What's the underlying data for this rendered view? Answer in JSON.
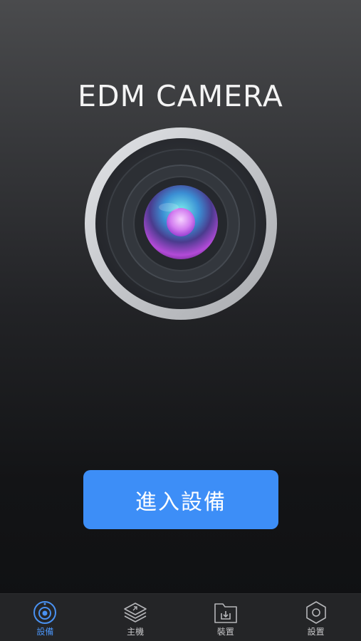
{
  "app": {
    "title": "EDM CAMERA"
  },
  "main": {
    "enter_button_label": "進入設備"
  },
  "tabbar": {
    "items": [
      {
        "label": "設備",
        "icon": "camera-icon",
        "active": true
      },
      {
        "label": "主機",
        "icon": "layers-icon",
        "active": false
      },
      {
        "label": "裝置",
        "icon": "folder-download-icon",
        "active": false
      },
      {
        "label": "設置",
        "icon": "settings-hexagon-icon",
        "active": false
      }
    ]
  },
  "colors": {
    "accent": "#3d8ef7",
    "active_tab": "#4a92f2",
    "inactive_tab": "#c7c7c9",
    "tabbar_bg": "#242527"
  }
}
